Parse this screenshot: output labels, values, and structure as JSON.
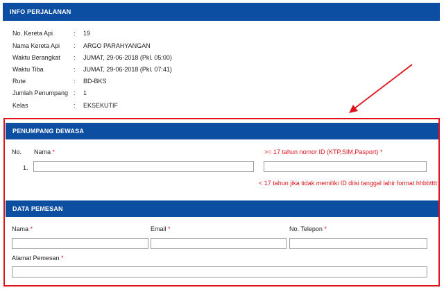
{
  "info": {
    "title": "INFO PERJALANAN",
    "rows": [
      {
        "label": "No. Kereta Api",
        "value": "19"
      },
      {
        "label": "Nama Kereta Api",
        "value": "ARGO PARAHYANGAN"
      },
      {
        "label": "Waktu Berangkat",
        "value": "JUMAT, 29-06-2018 (Pkl. 05:00)"
      },
      {
        "label": "Waktu Tiba",
        "value": "JUMAT, 29-06-2018 (Pkl. 07:41)"
      },
      {
        "label": "Rute",
        "value": "BD-BKS"
      },
      {
        "label": "Jumlah Penumpang",
        "value": "1"
      },
      {
        "label": "Kelas",
        "value": "EKSEKUTIF"
      }
    ],
    "colon": ":"
  },
  "penumpang": {
    "title": "PENUMPANG DEWASA",
    "col_no": "No.",
    "col_nama": "Nama",
    "col_id": ">= 17 tahun nomor ID (KTP,SIM,Pasport)",
    "required_mark": "*",
    "row_number": "1.",
    "note": "< 17 tahun jika tidak memiliki ID diisi tanggal lahir format hhbbtttt"
  },
  "pemesan": {
    "title": "DATA PEMESAN",
    "nama_label": "Nama",
    "email_label": "Email",
    "telepon_label": "No. Telepon",
    "alamat_label": "Alamat Pemesan",
    "required_mark": "*"
  },
  "colors": {
    "header_bg": "#0c4ea2",
    "highlight": "#e0141d",
    "required": "#e0141d"
  }
}
